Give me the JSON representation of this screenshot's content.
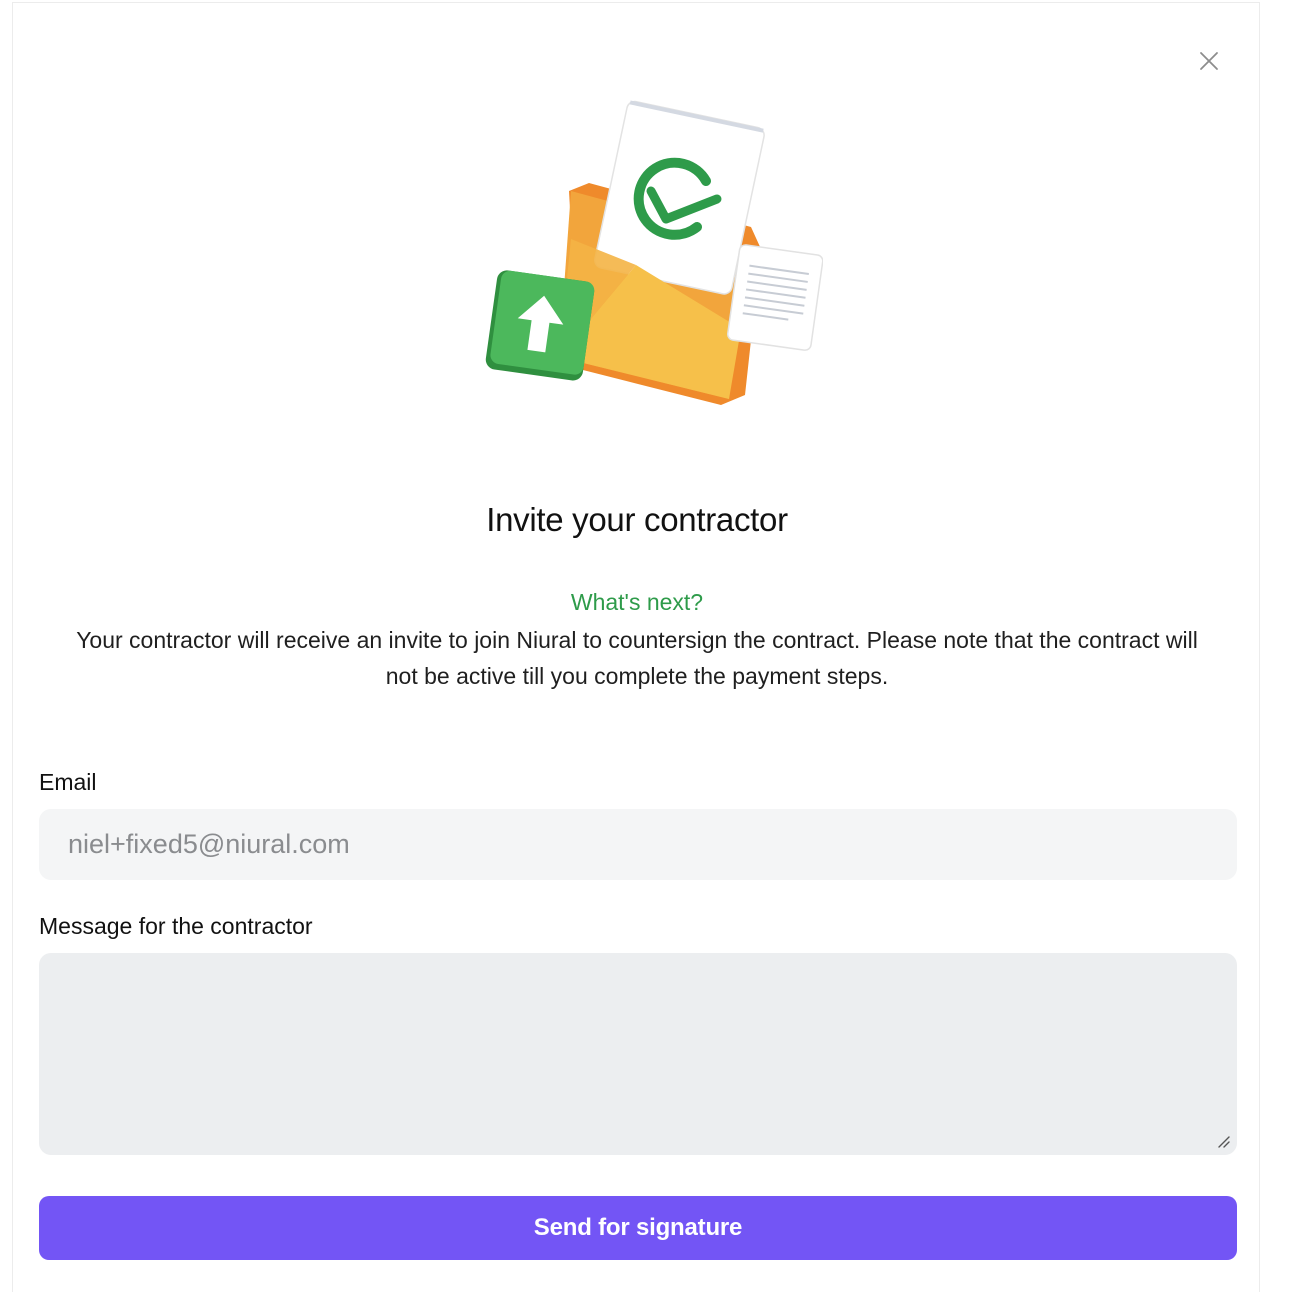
{
  "modal": {
    "title": "Invite your contractor",
    "subheading": "What's next?",
    "description": "Your contractor will receive an invite to join Niural to countersign the contract. Please note that the contract will not be active till you complete the payment steps.",
    "close_icon": "close-icon",
    "illustration_icon": "envelope-signature-illustration"
  },
  "form": {
    "email_label": "Email",
    "email_value": "niel+fixed5@niural.com",
    "message_label": "Message for the contractor",
    "message_value": "",
    "submit_label": "Send for signature"
  },
  "colors": {
    "accent": "#7355f5",
    "success": "#2e9b4a"
  }
}
